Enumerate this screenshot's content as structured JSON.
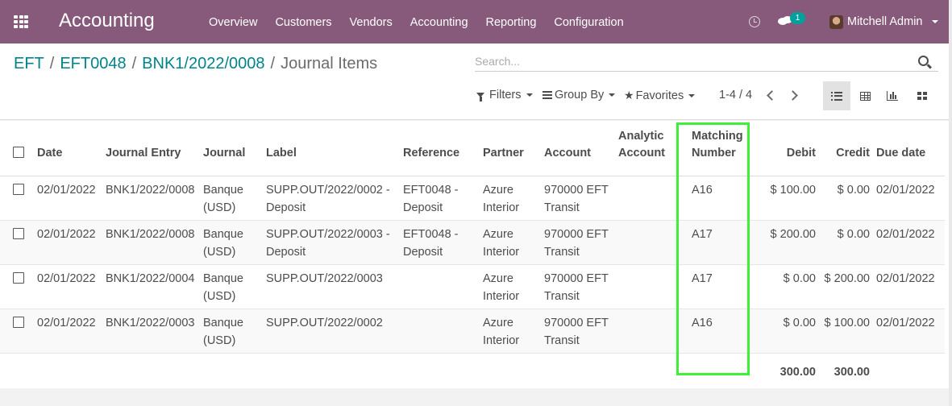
{
  "navbar": {
    "app_title": "Accounting",
    "menu": [
      "Overview",
      "Customers",
      "Vendors",
      "Accounting",
      "Reporting",
      "Configuration"
    ],
    "chat_badge": "1",
    "user_name": "Mitchell Admin",
    "icons": [
      "apps-grid-icon",
      "clock-icon",
      "chat-icon",
      "avatar"
    ],
    "brand_color": "#875a7b"
  },
  "breadcrumb": {
    "items": [
      "EFT",
      "EFT0048",
      "BNK1/2022/0008"
    ],
    "current": "Journal Items"
  },
  "search": {
    "placeholder": "Search..."
  },
  "controls": {
    "filters": "Filters",
    "group_by": "Group By",
    "favorites": "Favorites",
    "pager": "1-4 / 4"
  },
  "table": {
    "headers": {
      "date": "Date",
      "journal_entry": "Journal Entry",
      "journal": "Journal",
      "label": "Label",
      "reference": "Reference",
      "partner": "Partner",
      "account": "Account",
      "analytic_account": "Analytic Account",
      "matching_number": "Matching Number",
      "debit": "Debit",
      "credit": "Credit",
      "due_date": "Due date"
    },
    "rows": [
      {
        "date": "02/01/2022",
        "journal_entry": "BNK1/2022/0008",
        "journal": "Banque (USD)",
        "label": "SUPP.OUT/2022/0002 - Deposit",
        "reference": "EFT0048 - Deposit",
        "partner": "Azure Interior",
        "account": "970000 EFT Transit",
        "analytic_account": "",
        "matching_number": "A16",
        "debit": "$ 100.00",
        "credit": "$ 0.00",
        "due_date": "02/01/2022"
      },
      {
        "date": "02/01/2022",
        "journal_entry": "BNK1/2022/0008",
        "journal": "Banque (USD)",
        "label": "SUPP.OUT/2022/0003 - Deposit",
        "reference": "EFT0048 - Deposit",
        "partner": "Azure Interior",
        "account": "970000 EFT Transit",
        "analytic_account": "",
        "matching_number": "A17",
        "debit": "$ 200.00",
        "credit": "$ 0.00",
        "due_date": "02/01/2022"
      },
      {
        "date": "02/01/2022",
        "journal_entry": "BNK1/2022/0004",
        "journal": "Banque (USD)",
        "label": "SUPP.OUT/2022/0003",
        "reference": "",
        "partner": "Azure Interior",
        "account": "970000 EFT Transit",
        "analytic_account": "",
        "matching_number": "A17",
        "debit": "$ 0.00",
        "credit": "$ 200.00",
        "due_date": "02/01/2022"
      },
      {
        "date": "02/01/2022",
        "journal_entry": "BNK1/2022/0003",
        "journal": "Banque (USD)",
        "label": "SUPP.OUT/2022/0002",
        "reference": "",
        "partner": "Azure Interior",
        "account": "970000 EFT Transit",
        "analytic_account": "",
        "matching_number": "A16",
        "debit": "$ 0.00",
        "credit": "$ 100.00",
        "due_date": "02/01/2022"
      }
    ],
    "totals": {
      "debit": "300.00",
      "credit": "300.00"
    }
  },
  "colors": {
    "link": "#00848a",
    "highlight_box": "#40f038"
  }
}
